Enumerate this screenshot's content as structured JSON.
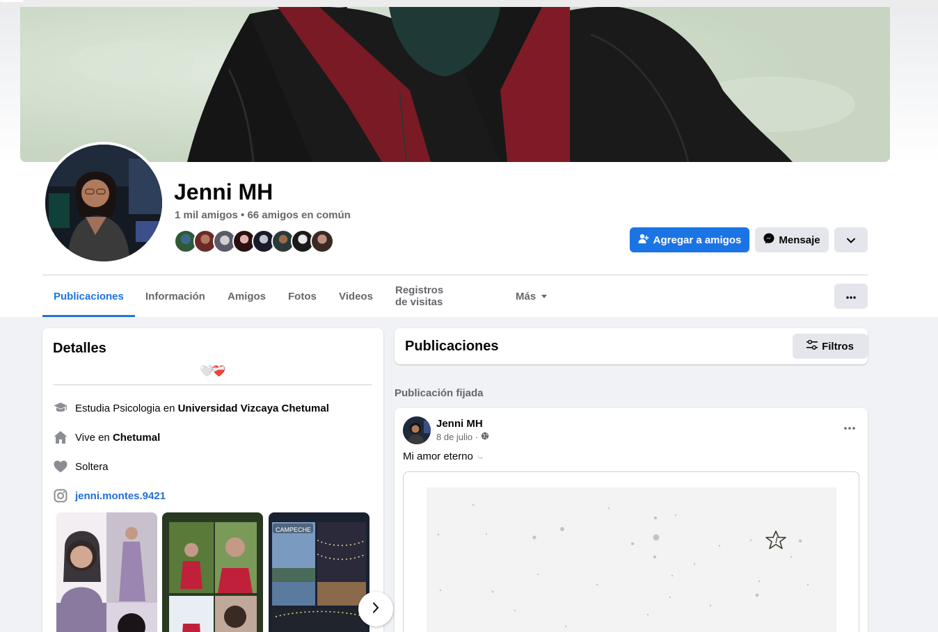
{
  "profile": {
    "name": "Jenni MH",
    "friend_count": "1 mil amigos • 66 amigos en común"
  },
  "actions": {
    "add_friend": "Agregar a amigos",
    "message": "Mensaje"
  },
  "tabs": [
    {
      "label": "Publicaciones",
      "active": true
    },
    {
      "label": "Información",
      "active": false
    },
    {
      "label": "Amigos",
      "active": false
    },
    {
      "label": "Fotos",
      "active": false
    },
    {
      "label": "Videos",
      "active": false
    },
    {
      "label": "Registros de visitas",
      "active": false
    },
    {
      "label": "Más",
      "active": false
    }
  ],
  "details": {
    "title": "Detalles",
    "bio": "🤍❤️‍🩹",
    "rows": [
      {
        "icon": "graduation-cap-icon",
        "prefix": "Estudia Psicologia en ",
        "bold": "Universidad Vizcaya Chetumal"
      },
      {
        "icon": "home-icon",
        "prefix": "Vive en ",
        "bold": "Chetumal"
      },
      {
        "icon": "heart-icon",
        "prefix": "Soltera",
        "bold": ""
      },
      {
        "icon": "instagram-icon",
        "prefix": "",
        "bold": "jenni.montes.9421"
      }
    ],
    "featured_tag": "CAMPECHE"
  },
  "posts": {
    "title": "Publicaciones",
    "filters": "Filtros",
    "pinned_label": "Publicación fijada",
    "pinned_post": {
      "author": "Jenni MH",
      "date": "8 de julio ·",
      "text": "Mi amor eterno"
    }
  },
  "colors": {
    "accent": "#1b74e4",
    "link": "#216fdb",
    "secondary_bg": "#e4e6eb",
    "page_bg": "#f0f2f5"
  }
}
